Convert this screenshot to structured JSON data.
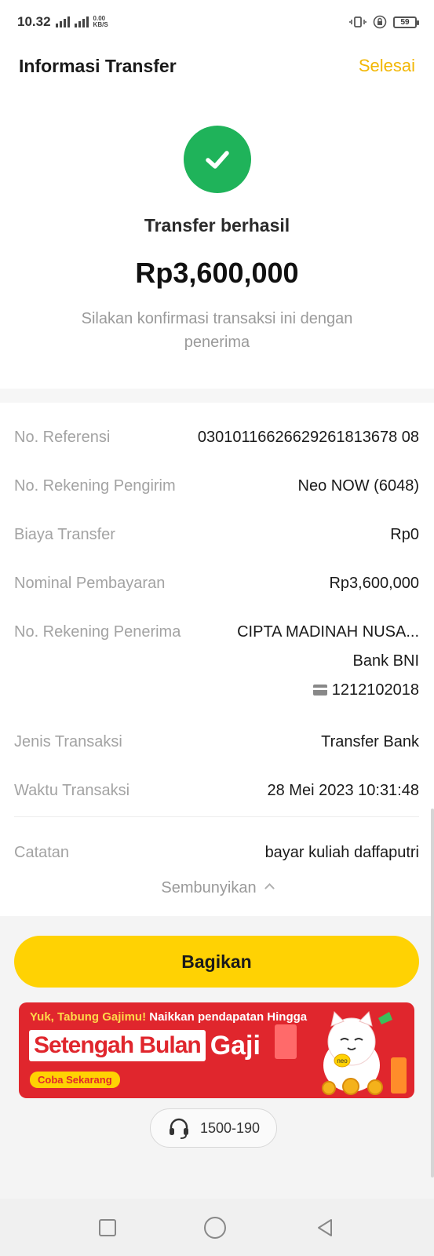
{
  "status_bar": {
    "time": "10.32",
    "network": "4G",
    "speed_value": "0.00",
    "speed_unit": "KB/S",
    "battery": "59"
  },
  "header": {
    "title": "Informasi Transfer",
    "done_label": "Selesai"
  },
  "result": {
    "status_icon": "checkmark-icon",
    "title": "Transfer berhasil",
    "amount": "Rp3,600,000",
    "subtitle": "Silakan konfirmasi transaksi ini dengan penerima"
  },
  "details": {
    "reference": {
      "label": "No. Referensi",
      "value": "03010116626629261813678 08"
    },
    "sender": {
      "label": "No. Rekening Pengirim",
      "value": "Neo NOW (6048)"
    },
    "fee": {
      "label": "Biaya Transfer",
      "value": "Rp0"
    },
    "nominal": {
      "label": "Nominal Pembayaran",
      "value": "Rp3,600,000"
    },
    "recipient": {
      "label": "No. Rekening Penerima",
      "name": "CIPTA MADINAH NUSA...",
      "bank": "Bank BNI",
      "account": "1212102018"
    },
    "type": {
      "label": "Jenis Transaksi",
      "value": "Transfer Bank"
    },
    "time": {
      "label": "Waktu Transaksi",
      "value": "28 Mei 2023 10:31:48"
    },
    "note": {
      "label": "Catatan",
      "value": "bayar kuliah daffaputri"
    }
  },
  "toggle": {
    "label": "Sembunyikan"
  },
  "share_button": {
    "label": "Bagikan"
  },
  "banner": {
    "line1_highlight": "Yuk, Tabung Gajimu!",
    "line1_rest": "Naikkan pendapatan Hingga",
    "headline": "Setengah Bulan",
    "headline_tail": "Gaji",
    "cta": "Coba Sekarang",
    "mascot_badge": "neo"
  },
  "hotline": {
    "number": "1500-190"
  }
}
